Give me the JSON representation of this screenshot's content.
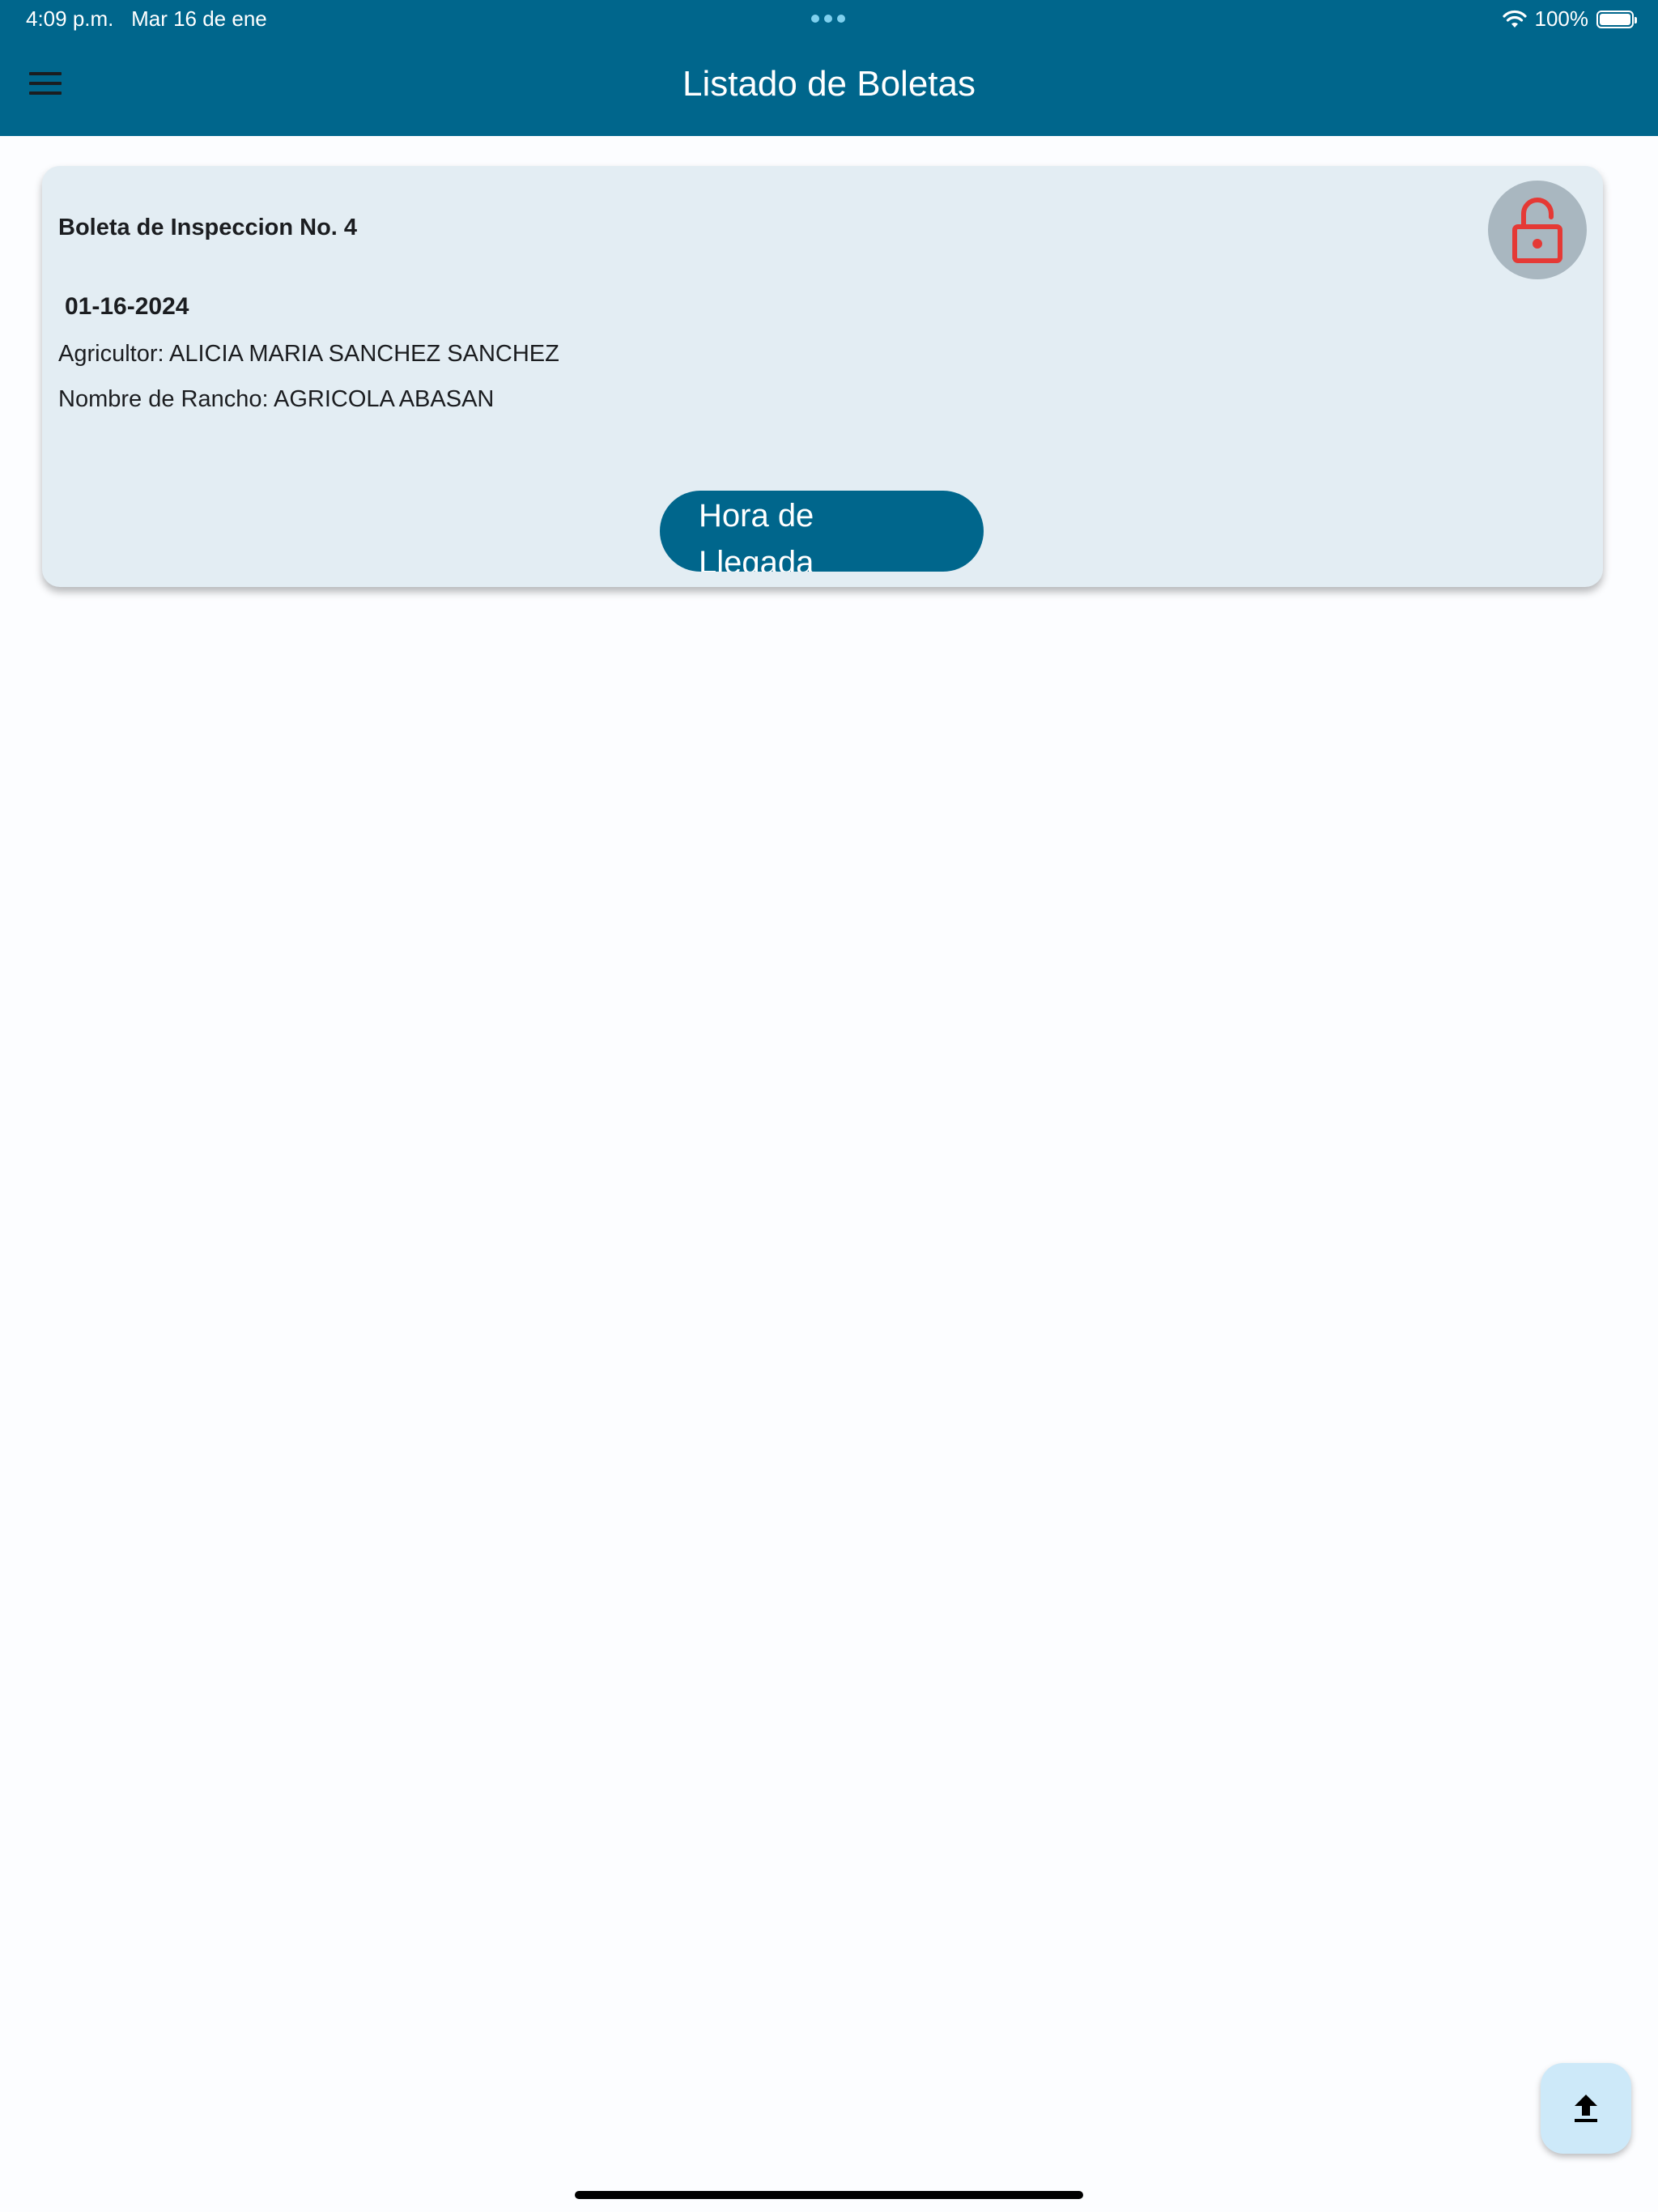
{
  "status_bar": {
    "time": "4:09 p.m.",
    "date": "Mar 16 de ene",
    "battery": "100%"
  },
  "header": {
    "title": "Listado de Boletas"
  },
  "card": {
    "title": "Boleta de Inspeccion No. 4",
    "date": "01-16-2024",
    "farmer": "Agricultor: ALICIA MARIA SANCHEZ SANCHEZ",
    "ranch": "Nombre de Rancho: AGRICOLA ABASAN",
    "arrival_button_label": "Hora de Llegada"
  },
  "icons": {
    "menu": "hamburger-menu-icon",
    "lock": "lock-open-icon",
    "upload": "upload-icon"
  },
  "colors": {
    "primary": "#00668c",
    "card_background": "#e3edf3",
    "lock_icon": "#e53935",
    "fab_background": "#cde9f9"
  }
}
